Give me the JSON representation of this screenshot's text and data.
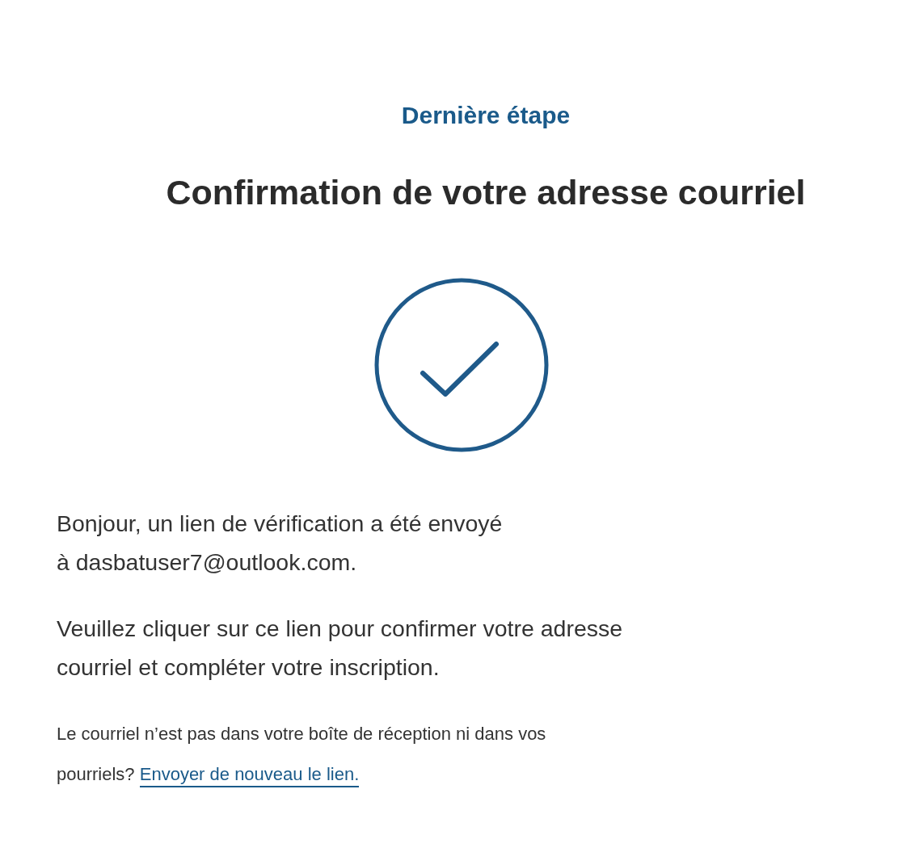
{
  "step_label": "Dernière étape",
  "title": "Confirmation de votre adresse courriel",
  "paragraphs": [
    [
      "Bonjour, un lien de vérification a été envoyé",
      "à dasbatuser7@outlook.com."
    ],
    [
      "Veuillez cliquer sur ce lien pour confirmer votre adresse",
      "courriel et compléter votre inscription."
    ]
  ],
  "note": {
    "lines": [
      "Le courriel n’est pas dans votre boîte de réception ni dans vos",
      "pourriels?"
    ],
    "link": "Envoyer de nouveau le lien."
  }
}
